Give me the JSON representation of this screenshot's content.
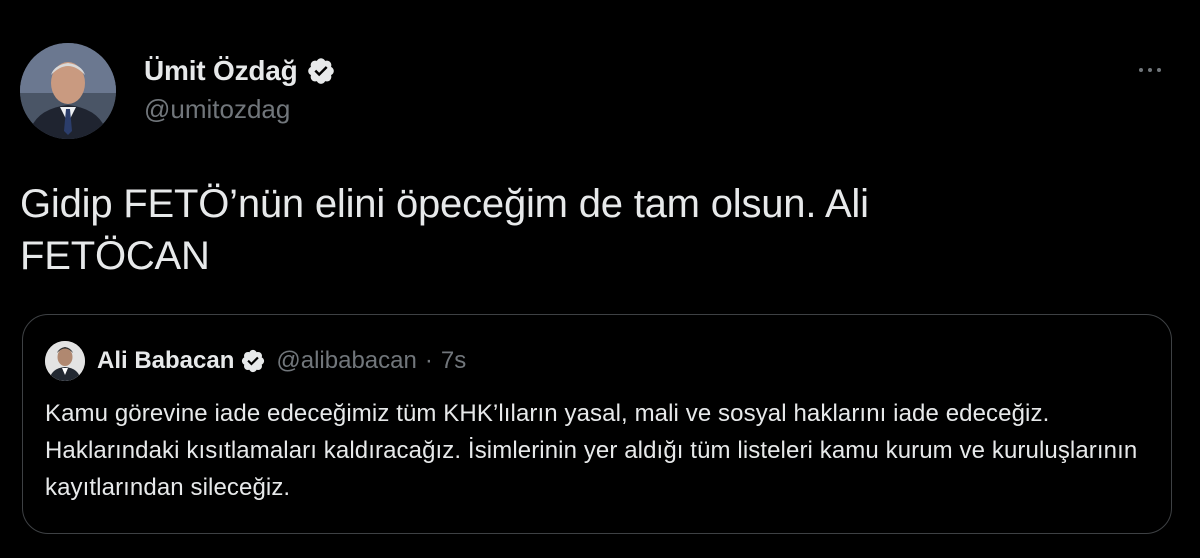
{
  "colors": {
    "background": "#000000",
    "text_primary": "#e7e9ea",
    "text_secondary": "#71767b",
    "border": "#3e4144",
    "verified_badge": "#e7e9ea"
  },
  "tweet": {
    "author": {
      "display_name": "Ümit Özdağ",
      "handle": "@umitozdag",
      "verified": true
    },
    "more_icon": "more-horizontal-icon",
    "text": "Gidip FETÖ’nün elini öpeceğim de tam olsun. Ali\nFETÖCAN"
  },
  "quoted_tweet": {
    "author": {
      "display_name": "Ali Babacan",
      "handle": "@alibabacan",
      "verified": true
    },
    "separator": "·",
    "time": "7s",
    "text": "Kamu görevine iade edeceğimiz tüm KHK’lıların yasal, mali ve sosyal haklarını iade edeceğiz. Haklarındaki kısıtlamaları kaldıracağız. İsimlerinin yer aldığı tüm listeleri kamu kurum ve kuruluşlarının kayıtlarından sileceğiz."
  }
}
